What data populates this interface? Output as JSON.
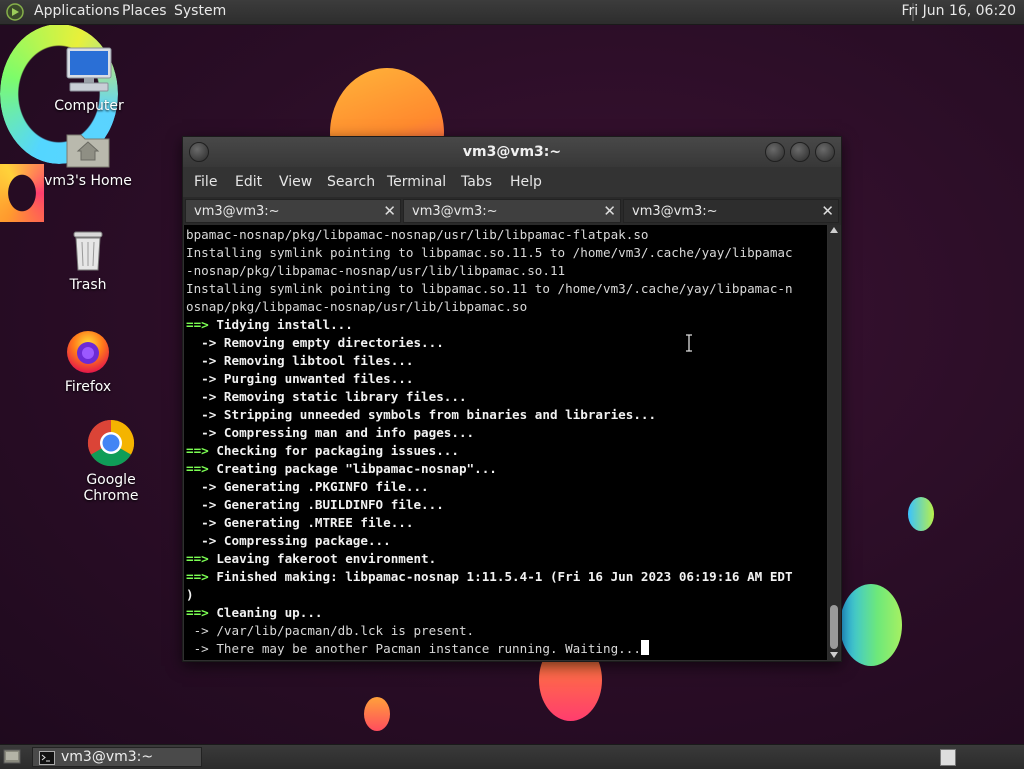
{
  "top_panel": {
    "menus": [
      "Applications",
      "Places",
      "System"
    ],
    "clock": "Fri Jun 16, 06:20"
  },
  "desktop_icons": [
    {
      "label": "Computer",
      "icon": "computer-icon"
    },
    {
      "label": "vm3's Home",
      "icon": "home-folder-icon"
    },
    {
      "label": "Trash",
      "icon": "trash-icon"
    },
    {
      "label": "Firefox",
      "icon": "firefox-icon"
    },
    {
      "label": "Google Chrome",
      "icon": "chrome-icon"
    }
  ],
  "terminal": {
    "title": "vm3@vm3:~",
    "menu": [
      "File",
      "Edit",
      "View",
      "Search",
      "Terminal",
      "Tabs",
      "Help"
    ],
    "tabs": [
      {
        "label": "vm3@vm3:~",
        "active": false
      },
      {
        "label": "vm3@vm3:~",
        "active": false
      },
      {
        "label": "vm3@vm3:~",
        "active": true
      }
    ],
    "close_glyph": "✕",
    "lines": [
      {
        "prefix": "",
        "text": "bpamac-nosnap/pkg/libpamac-nosnap/usr/lib/libpamac-flatpak.so",
        "bold": false
      },
      {
        "prefix": "",
        "text": "Installing symlink pointing to libpamac.so.11.5 to /home/vm3/.cache/yay/libpamac",
        "bold": false
      },
      {
        "prefix": "",
        "text": "-nosnap/pkg/libpamac-nosnap/usr/lib/libpamac.so.11",
        "bold": false
      },
      {
        "prefix": "",
        "text": "Installing symlink pointing to libpamac.so.11 to /home/vm3/.cache/yay/libpamac-n",
        "bold": false
      },
      {
        "prefix": "",
        "text": "osnap/pkg/libpamac-nosnap/usr/lib/libpamac.so",
        "bold": false
      },
      {
        "prefix": "==>",
        "text": " Tidying install...",
        "bold": true
      },
      {
        "prefix": "",
        "text": "  -> Removing empty directories...",
        "bold": true
      },
      {
        "prefix": "",
        "text": "  -> Removing libtool files...",
        "bold": true
      },
      {
        "prefix": "",
        "text": "  -> Purging unwanted files...",
        "bold": true
      },
      {
        "prefix": "",
        "text": "  -> Removing static library files...",
        "bold": true
      },
      {
        "prefix": "",
        "text": "  -> Stripping unneeded symbols from binaries and libraries...",
        "bold": true
      },
      {
        "prefix": "",
        "text": "  -> Compressing man and info pages...",
        "bold": true
      },
      {
        "prefix": "==>",
        "text": " Checking for packaging issues...",
        "bold": true
      },
      {
        "prefix": "==>",
        "text": " Creating package \"libpamac-nosnap\"...",
        "bold": true
      },
      {
        "prefix": "",
        "text": "  -> Generating .PKGINFO file...",
        "bold": true
      },
      {
        "prefix": "",
        "text": "  -> Generating .BUILDINFO file...",
        "bold": true
      },
      {
        "prefix": "",
        "text": "  -> Generating .MTREE file...",
        "bold": true
      },
      {
        "prefix": "",
        "text": "  -> Compressing package...",
        "bold": true
      },
      {
        "prefix": "==>",
        "text": " Leaving fakeroot environment.",
        "bold": true
      },
      {
        "prefix": "==>",
        "text": " Finished making: libpamac-nosnap 1:11.5.4-1 (Fri 16 Jun 2023 06:19:16 AM EDT",
        "bold": true
      },
      {
        "prefix": "",
        "text": ")",
        "bold": true
      },
      {
        "prefix": "==>",
        "text": " Cleaning up...",
        "bold": true
      },
      {
        "prefix": "",
        "text": " -> /var/lib/pacman/db.lck is present.",
        "bold": false
      },
      {
        "prefix": "",
        "text": " -> There may be another Pacman instance running. Waiting...",
        "bold": false,
        "cursor": true
      }
    ]
  },
  "taskbar": {
    "task_label": "vm3@vm3:~"
  }
}
